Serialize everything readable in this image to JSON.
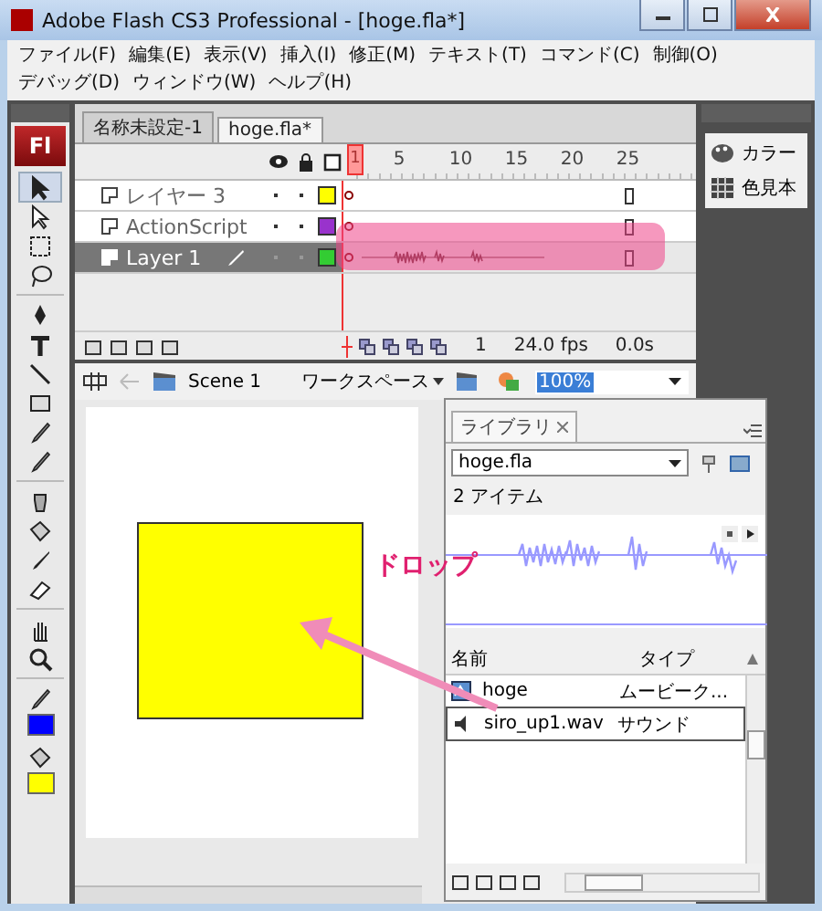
{
  "window": {
    "title": "Adobe Flash CS3 Professional - [hoge.fla*]"
  },
  "menu_bar": [
    {
      "label": "ファイル(F)"
    },
    {
      "label": "編集(E)"
    },
    {
      "label": "表示(V)"
    },
    {
      "label": "挿入(I)"
    },
    {
      "label": "修正(M)"
    },
    {
      "label": "テキスト(T)"
    },
    {
      "label": "コマンド(C)"
    },
    {
      "label": "制御(O)"
    },
    {
      "label": "デバッグ(D)"
    },
    {
      "label": "ウィンドウ(W)"
    },
    {
      "label": "ヘルプ(H)"
    }
  ],
  "tools": {
    "logo": "Fl",
    "swatches": [
      {
        "kind": "stroke",
        "color": "#0000ff"
      },
      {
        "kind": "fill",
        "color": "#ffff00"
      }
    ]
  },
  "tabs": [
    {
      "label": "名称未設定-1",
      "selected": false
    },
    {
      "label": "hoge.fla*",
      "selected": true
    }
  ],
  "timeline": {
    "frame_numbers": [
      {
        "frame": "1"
      },
      {
        "frame": "5"
      },
      {
        "frame": "10"
      },
      {
        "frame": "15"
      },
      {
        "frame": "20"
      },
      {
        "frame": "25"
      }
    ],
    "layers": [
      {
        "name": "レイヤー 3",
        "color": "#ffff00",
        "selected": false,
        "sound": false
      },
      {
        "name": "ActionScript",
        "color": "#9933cc",
        "selected": false,
        "sound": false
      },
      {
        "name": "Layer 1",
        "color": "#33cc33",
        "selected": true,
        "sound": true
      }
    ],
    "current_frame": "1",
    "fps": "24.0 fps",
    "time": "0.0s"
  },
  "edit_bar": {
    "scene": "Scene 1",
    "workspace": "ワークスペース",
    "zoom": "100%"
  },
  "stage": {
    "annotation": "ドロップ"
  },
  "side_panels": [
    {
      "label": "カラー"
    },
    {
      "label": "色見本"
    }
  ],
  "library": {
    "tab": "ライブラリ",
    "file": "hoge.fla",
    "count": "2 アイテム",
    "columns": [
      "名前",
      "タイプ"
    ],
    "items": [
      {
        "name": "hoge",
        "type": "ムービーク...",
        "kind": "movie",
        "selected": false
      },
      {
        "name": "siro_up1.wav",
        "type": "サウンド",
        "kind": "sound",
        "selected": true
      }
    ]
  }
}
